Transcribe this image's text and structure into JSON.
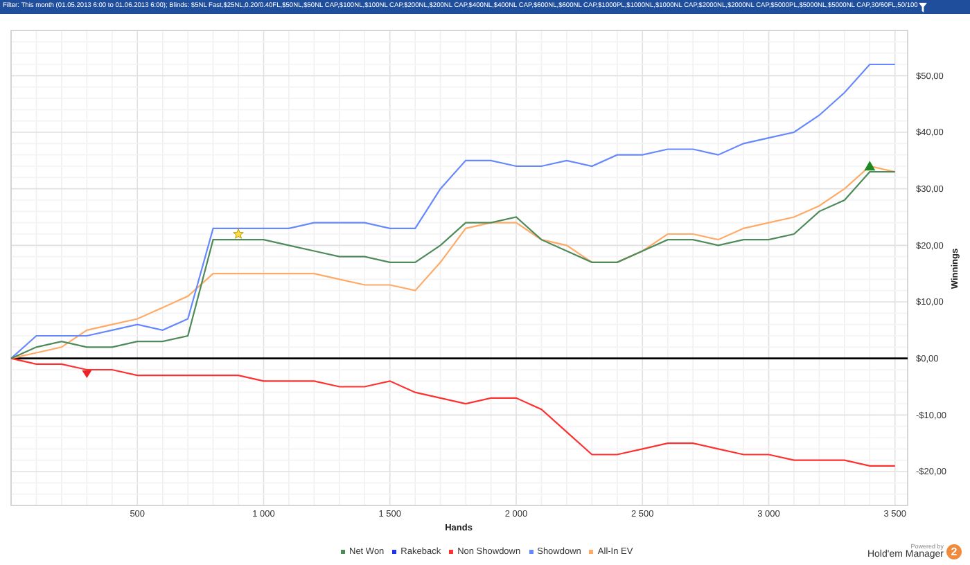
{
  "filter_bar": {
    "text": "Filter: This month (01.05.2013 6:00 to 01.06.2013 6:00); Blinds: $5NL Fast,$25NL,0.20/0.40FL,$50NL,$50NL CAP,$100NL,$100NL CAP,$200NL,$200NL CAP,$400NL,$400NL CAP,$600NL,$600NL CAP,$1000PL,$1000NL,$1000NL CAP,$2000NL,$2000NL CAP,$5000PL,$5000NL,$5000NL CAP,30/60FL,50/100"
  },
  "chart": {
    "chart_data": {
      "type": "line",
      "xlabel": "Hands",
      "ylabel": "Winnings",
      "grid": true,
      "x": [
        0,
        100,
        200,
        300,
        400,
        500,
        600,
        700,
        800,
        900,
        1000,
        1100,
        1200,
        1300,
        1400,
        1500,
        1600,
        1700,
        1800,
        1900,
        2000,
        2100,
        2200,
        2300,
        2400,
        2500,
        2600,
        2700,
        2800,
        2900,
        3000,
        3100,
        3200,
        3300,
        3400,
        3500
      ],
      "series": [
        {
          "name": "Net Won",
          "color": "#4f8a5a",
          "values": [
            0,
            2,
            3,
            2,
            2,
            3,
            3,
            4,
            21,
            21,
            21,
            20,
            19,
            18,
            18,
            17,
            17,
            20,
            24,
            24,
            25,
            21,
            19,
            17,
            17,
            19,
            21,
            21,
            20,
            21,
            21,
            22,
            26,
            28,
            33,
            33
          ]
        },
        {
          "name": "Rakeback",
          "color": "#2233ee",
          "values": [
            null,
            null,
            null,
            null,
            null,
            null,
            null,
            null,
            null,
            null,
            null,
            null,
            null,
            null,
            null,
            null,
            null,
            null,
            null,
            null,
            null,
            null,
            null,
            null,
            null,
            null,
            null,
            null,
            null,
            null,
            null,
            null,
            null,
            null,
            null,
            null
          ]
        },
        {
          "name": "Non Showdown",
          "color": "#ff3030",
          "values": [
            0,
            -1,
            -1,
            -2,
            -2,
            -3,
            -3,
            -3,
            -3,
            -3,
            -4,
            -4,
            -4,
            -5,
            -5,
            -4,
            -6,
            -7,
            -8,
            -7,
            -7,
            -9,
            -13,
            -17,
            -17,
            -16,
            -15,
            -15,
            -16,
            -17,
            -17,
            -18,
            -18,
            -18,
            -19,
            -19
          ]
        },
        {
          "name": "Showdown",
          "color": "#6688ff",
          "values": [
            0,
            4,
            4,
            4,
            5,
            6,
            5,
            7,
            23,
            23,
            23,
            23,
            24,
            24,
            24,
            23,
            23,
            30,
            35,
            35,
            34,
            34,
            35,
            34,
            36,
            36,
            37,
            37,
            36,
            38,
            39,
            40,
            43,
            47,
            52,
            52
          ]
        },
        {
          "name": "All-In EV",
          "color": "#ffaa66",
          "values": [
            0,
            1,
            2,
            5,
            6,
            7,
            9,
            11,
            15,
            15,
            15,
            15,
            15,
            14,
            13,
            13,
            12,
            17,
            23,
            24,
            24,
            21,
            20,
            17,
            17,
            19,
            22,
            22,
            21,
            23,
            24,
            25,
            27,
            30,
            34,
            33
          ]
        }
      ],
      "xlim": [
        0,
        3550
      ],
      "ylim": [
        -26,
        58
      ],
      "xticks": [
        {
          "value": 500,
          "label": "500"
        },
        {
          "value": 1000,
          "label": "1 000"
        },
        {
          "value": 1500,
          "label": "1 500"
        },
        {
          "value": 2000,
          "label": "2 000"
        },
        {
          "value": 2500,
          "label": "2 500"
        },
        {
          "value": 3000,
          "label": "3 000"
        },
        {
          "value": 3500,
          "label": "3 500"
        }
      ],
      "yticks": [
        {
          "value": 50,
          "label": "$50,00"
        },
        {
          "value": 40,
          "label": "$40,00"
        },
        {
          "value": 30,
          "label": "$30,00"
        },
        {
          "value": 20,
          "label": "$20,00"
        },
        {
          "value": 10,
          "label": "$10,00"
        },
        {
          "value": 0,
          "label": "$0,00"
        },
        {
          "value": -10,
          "label": "-$10,00"
        },
        {
          "value": -20,
          "label": "-$20,00"
        }
      ]
    }
  },
  "branding": {
    "powered_by": "Powered by",
    "product": "Hold'em Manager",
    "badge": "2"
  }
}
